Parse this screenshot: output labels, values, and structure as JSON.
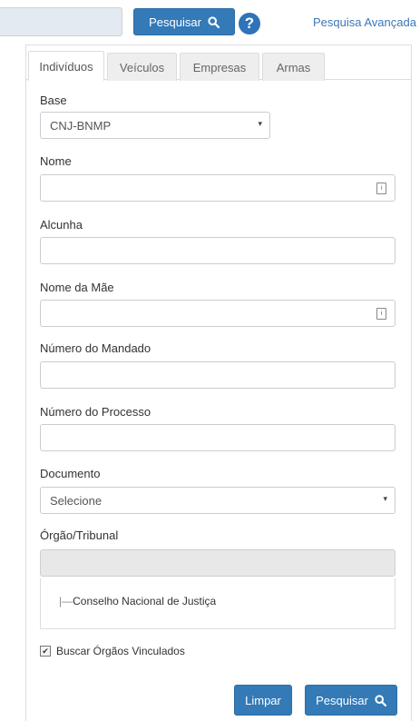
{
  "topbar": {
    "search_label": "Pesquisar",
    "help_icon": "question-circle-icon",
    "advanced_label": "Pesquisa Avançada",
    "advanced_caret": "▾"
  },
  "tabs": [
    {
      "label": "Indivíduos",
      "active": true
    },
    {
      "label": "Veículos",
      "active": false
    },
    {
      "label": "Empresas",
      "active": false
    },
    {
      "label": "Armas",
      "active": false
    }
  ],
  "form": {
    "base_label": "Base",
    "base_value": "CNJ-BNMP",
    "nome_label": "Nome",
    "nome_value": "",
    "alcunha_label": "Alcunha",
    "alcunha_value": "",
    "mae_label": "Nome da Mãe",
    "mae_value": "",
    "mandado_label": "Número do Mandado",
    "mandado_value": "",
    "processo_label": "Número do Processo",
    "processo_value": "",
    "documento_label": "Documento",
    "documento_value": "Selecione",
    "orgao_label": "Órgão/Tribunal",
    "orgao_value": "",
    "tree_item": "Conselho Nacional de Justiça",
    "tree_connector": "|—",
    "vinculados_label": "Buscar Órgãos Vinculados",
    "vinculados_checked": true,
    "checkmark": "✔",
    "arrow": "▾",
    "field_icon_glyph": "i"
  },
  "actions": {
    "clear_label": "Limpar",
    "search_label": "Pesquisar"
  },
  "colors": {
    "primary": "#337ab7",
    "link": "#3a78b8",
    "caret": "#e09a2c"
  }
}
